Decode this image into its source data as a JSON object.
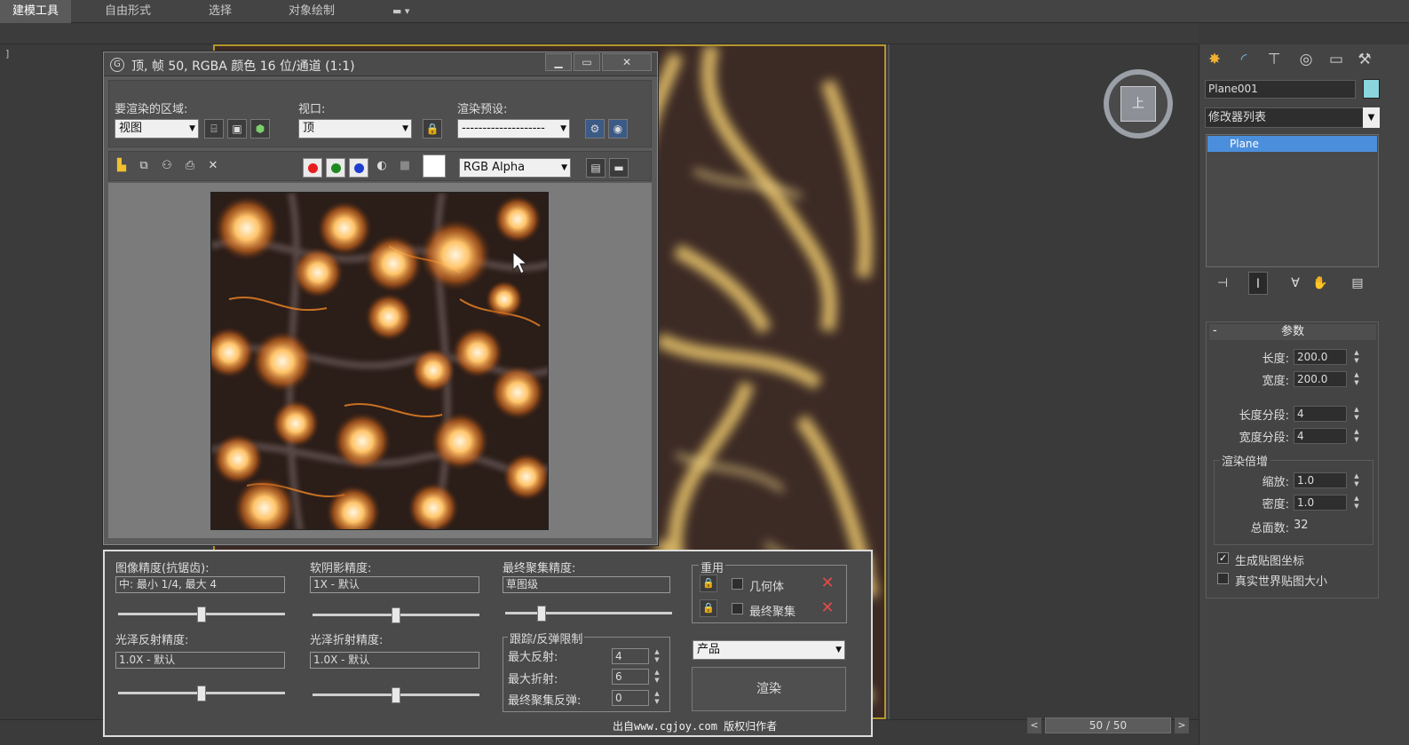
{
  "ribbon": {
    "tabs": [
      "建模工具",
      "自由形式",
      "选择",
      "对象绘制"
    ],
    "extra_icon": "dropdown-toggle-icon"
  },
  "viewport": {
    "left_label": "]",
    "viewcube_face": "上"
  },
  "frame_window": {
    "title": "顶, 帧 50, RGBA 颜色 16 位/通道 (1:1)",
    "buttons": {
      "minimize": "▁",
      "restore": "▭",
      "close": "✕"
    },
    "area_label": "要渲染的区域:",
    "area_value": "视图",
    "viewport_label": "视口:",
    "viewport_value": "顶",
    "preset_label": "渲染预设:",
    "preset_value": "--------------------",
    "channel_value": "RGB Alpha",
    "channel_colors": {
      "red": "#e81e1e",
      "green": "#1e8a1e",
      "blue": "#1e3ed0"
    }
  },
  "settings": {
    "image_precision_label": "图像精度(抗锯齿):",
    "image_precision_value": "中: 最小 1/4, 最大 4",
    "soft_shadow_label": "软阴影精度:",
    "soft_shadow_value": "1X - 默认",
    "final_gather_label": "最终聚集精度:",
    "final_gather_value": "草图级",
    "glossy_reflect_label": "光泽反射精度:",
    "glossy_reflect_value": "1.0X - 默认",
    "glossy_refract_label": "光泽折射精度:",
    "glossy_refract_value": "1.0X - 默认",
    "reuse_label": "重用",
    "reuse_geometry": "几何体",
    "reuse_final_gather": "最终聚集",
    "trace_label": "跟踪/反弹限制",
    "max_reflect_label": "最大反射:",
    "max_reflect_value": "4",
    "max_refract_label": "最大折射:",
    "max_refract_value": "6",
    "fg_bounce_label": "最终聚集反弹:",
    "fg_bounce_value": "0",
    "product_value": "产品",
    "render_button": "渲染",
    "slider_levels": {
      "image_precision": 0.5,
      "soft_shadow": 0.5,
      "final_gather": 0.2,
      "glossy_reflect": 0.5,
      "glossy_refract": 0.5
    }
  },
  "command_panel": {
    "object_name": "Plane001",
    "object_color": "#8ad6dc",
    "modifier_list": "修改器列表",
    "stack_item": "Plane",
    "params_title": "参数",
    "params_collapse": "-",
    "length_label": "长度:",
    "length_value": "200.0",
    "width_label": "宽度:",
    "width_value": "200.0",
    "length_segs_label": "长度分段:",
    "length_segs_value": "4",
    "width_segs_label": "宽度分段:",
    "width_segs_value": "4",
    "render_mult_label": "渲染倍增",
    "scale_label": "缩放:",
    "scale_value": "1.0",
    "density_label": "密度:",
    "density_value": "1.0",
    "total_faces_label": "总面数:",
    "total_faces_value": "32",
    "gen_map_coords": "生成贴图坐标",
    "gen_map_checked": true,
    "real_world_size": "真实世界贴图大小",
    "real_world_checked": false
  },
  "time_slider": {
    "value": "50 / 50",
    "prev": "<",
    "next": ">"
  },
  "watermark": "出自www.cgjoy.com 版权归作者"
}
